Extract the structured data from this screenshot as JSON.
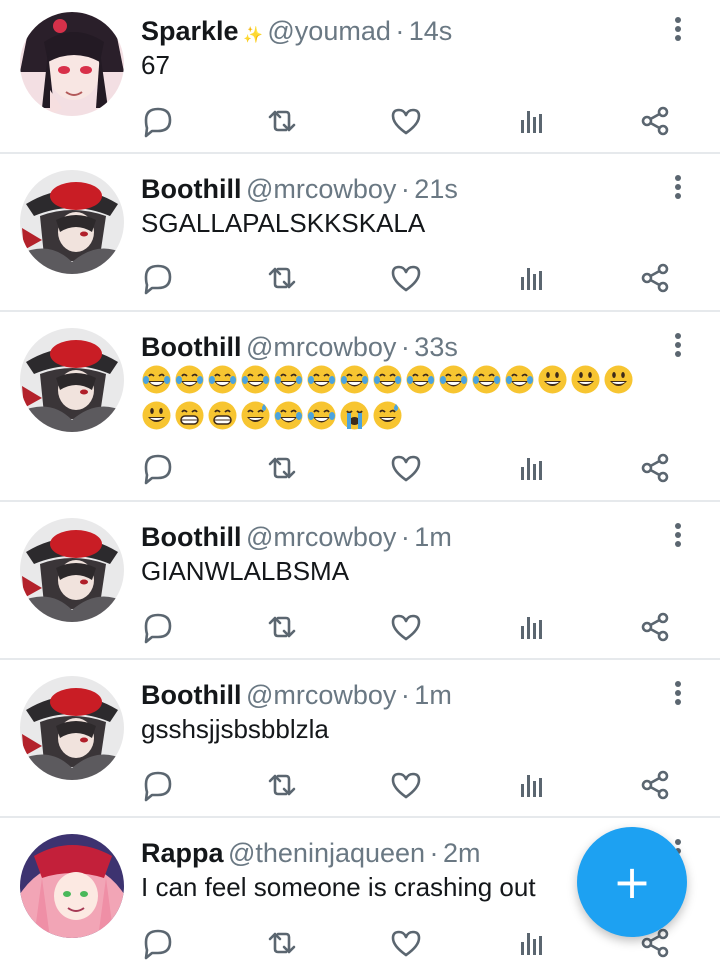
{
  "tweets": [
    {
      "name": "Sparkle",
      "name_emoji": "✨",
      "handle": "@youmad",
      "time": "14s",
      "text": "67",
      "avatar": "sparkle"
    },
    {
      "name": "Boothill",
      "handle": "@mrcowboy",
      "time": "21s",
      "text": "SGALLAPALSKKSKALA",
      "avatar": "boothill"
    },
    {
      "name": "Boothill",
      "handle": "@mrcowboy",
      "time": "33s",
      "text": "",
      "avatar": "boothill",
      "emoji_lines": [
        [
          "joy",
          "joy",
          "joy",
          "joy",
          "rofl",
          "rofl",
          "rofl",
          "rofl",
          "rofl",
          "rofl",
          "rofl",
          "rofl",
          "smiley",
          "smiley",
          "smiley"
        ],
        [
          "smiley",
          "grin",
          "grin",
          "sweat-smile",
          "joy",
          "joy",
          "sob",
          "sweat-smile"
        ]
      ]
    },
    {
      "name": "Boothill",
      "handle": "@mrcowboy",
      "time": "1m",
      "text": "GIANWLALBSMA",
      "avatar": "boothill"
    },
    {
      "name": "Boothill",
      "handle": "@mrcowboy",
      "time": "1m",
      "text": "gsshsjjsbsbblzla",
      "avatar": "boothill"
    },
    {
      "name": "Rappa",
      "handle": "@theninjaqueen",
      "time": "2m",
      "text": "I can feel someone is crashing out",
      "avatar": "rappa"
    }
  ],
  "separator": "·",
  "icons": {
    "reply": "reply-icon",
    "retweet": "retweet-icon",
    "like": "heart-icon",
    "views": "analytics-icon",
    "share": "share-icon",
    "menu": "more-vertical-icon",
    "compose": "plus-icon"
  },
  "fab": {
    "label": "+",
    "color": "#1da1f2"
  },
  "colors": {
    "divider": "#e6e9ec",
    "icon": "#5b6670",
    "name": "#14171a",
    "meta": "#6a7883"
  }
}
